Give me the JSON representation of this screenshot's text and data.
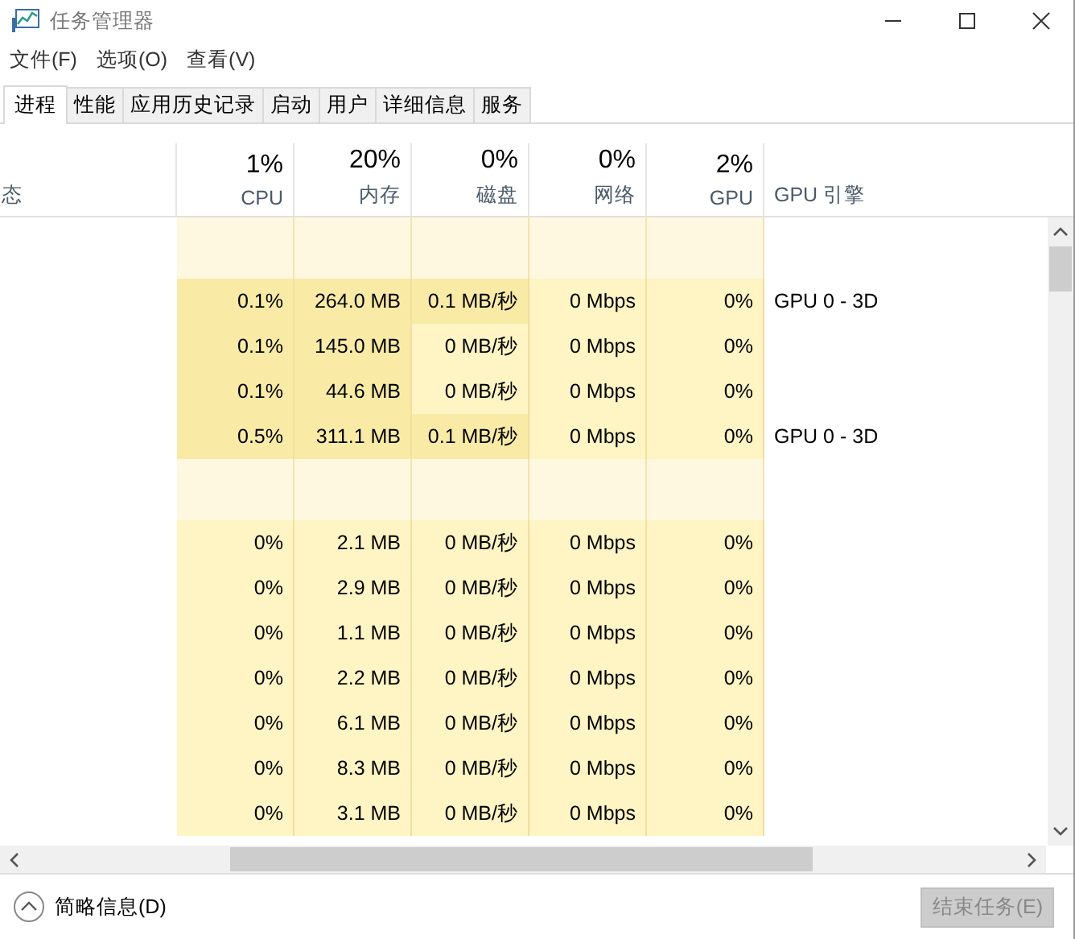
{
  "window": {
    "title": "任务管理器"
  },
  "menu": [
    "文件(F)",
    "选项(O)",
    "查看(V)"
  ],
  "tabs": [
    {
      "label": "进程",
      "selected": true
    },
    {
      "label": "性能",
      "selected": false
    },
    {
      "label": "应用历史记录",
      "selected": false
    },
    {
      "label": "启动",
      "selected": false
    },
    {
      "label": "用户",
      "selected": false
    },
    {
      "label": "详细信息",
      "selected": false
    },
    {
      "label": "服务",
      "selected": false
    }
  ],
  "table": {
    "columns": [
      {
        "label": "态"
      },
      {
        "percent": "1%",
        "label": "CPU"
      },
      {
        "percent": "20%",
        "label": "内存"
      },
      {
        "percent": "0%",
        "label": "磁盘"
      },
      {
        "percent": "0%",
        "label": "网络"
      },
      {
        "percent": "2%",
        "label": "GPU"
      },
      {
        "label": "GPU 引擎"
      }
    ],
    "rows": [
      {
        "kind": "group"
      },
      {
        "kind": "process",
        "cells": [
          {
            "text": "0.1%",
            "heat": true
          },
          {
            "text": "264.0 MB",
            "heat": true
          },
          {
            "text": "0.1 MB/秒",
            "heat": true
          },
          {
            "text": "0 Mbps",
            "heat": false
          },
          {
            "text": "0%",
            "heat": false
          }
        ],
        "engine": "GPU 0 - 3D"
      },
      {
        "kind": "process",
        "cells": [
          {
            "text": "0.1%",
            "heat": true
          },
          {
            "text": "145.0 MB",
            "heat": true
          },
          {
            "text": "0 MB/秒",
            "heat": false
          },
          {
            "text": "0 Mbps",
            "heat": false
          },
          {
            "text": "0%",
            "heat": false
          }
        ]
      },
      {
        "kind": "process",
        "cells": [
          {
            "text": "0.1%",
            "heat": true
          },
          {
            "text": "44.6 MB",
            "heat": true
          },
          {
            "text": "0 MB/秒",
            "heat": false
          },
          {
            "text": "0 Mbps",
            "heat": false
          },
          {
            "text": "0%",
            "heat": false
          }
        ]
      },
      {
        "kind": "process",
        "cells": [
          {
            "text": "0.5%",
            "heat": true
          },
          {
            "text": "311.1 MB",
            "heat": true
          },
          {
            "text": "0.1 MB/秒",
            "heat": true
          },
          {
            "text": "0 Mbps",
            "heat": false
          },
          {
            "text": "0%",
            "heat": false
          }
        ],
        "engine": "GPU 0 - 3D"
      },
      {
        "kind": "group"
      },
      {
        "kind": "process",
        "cells": [
          {
            "text": "0%",
            "heat": false
          },
          {
            "text": "2.1 MB",
            "heat": false
          },
          {
            "text": "0 MB/秒",
            "heat": false
          },
          {
            "text": "0 Mbps",
            "heat": false
          },
          {
            "text": "0%",
            "heat": false
          }
        ]
      },
      {
        "kind": "process",
        "cells": [
          {
            "text": "0%",
            "heat": false
          },
          {
            "text": "2.9 MB",
            "heat": false
          },
          {
            "text": "0 MB/秒",
            "heat": false
          },
          {
            "text": "0 Mbps",
            "heat": false
          },
          {
            "text": "0%",
            "heat": false
          }
        ]
      },
      {
        "kind": "process",
        "cells": [
          {
            "text": "0%",
            "heat": false
          },
          {
            "text": "1.1 MB",
            "heat": false
          },
          {
            "text": "0 MB/秒",
            "heat": false
          },
          {
            "text": "0 Mbps",
            "heat": false
          },
          {
            "text": "0%",
            "heat": false
          }
        ]
      },
      {
        "kind": "process",
        "cells": [
          {
            "text": "0%",
            "heat": false
          },
          {
            "text": "2.2 MB",
            "heat": false
          },
          {
            "text": "0 MB/秒",
            "heat": false
          },
          {
            "text": "0 Mbps",
            "heat": false
          },
          {
            "text": "0%",
            "heat": false
          }
        ]
      },
      {
        "kind": "process",
        "cells": [
          {
            "text": "0%",
            "heat": false
          },
          {
            "text": "6.1 MB",
            "heat": false
          },
          {
            "text": "0 MB/秒",
            "heat": false
          },
          {
            "text": "0 Mbps",
            "heat": false
          },
          {
            "text": "0%",
            "heat": false
          }
        ]
      },
      {
        "kind": "process",
        "cells": [
          {
            "text": "0%",
            "heat": false
          },
          {
            "text": "8.3 MB",
            "heat": false
          },
          {
            "text": "0 MB/秒",
            "heat": false
          },
          {
            "text": "0 Mbps",
            "heat": false
          },
          {
            "text": "0%",
            "heat": false
          }
        ]
      },
      {
        "kind": "process",
        "cells": [
          {
            "text": "0%",
            "heat": false
          },
          {
            "text": "3.1 MB",
            "heat": false
          },
          {
            "text": "0 MB/秒",
            "heat": false
          },
          {
            "text": "0 Mbps",
            "heat": false
          },
          {
            "text": "0%",
            "heat": false
          }
        ]
      }
    ]
  },
  "footer": {
    "details_toggle": "简略信息(D)",
    "end_task": {
      "label": "结束任务(E)",
      "disabled": true
    }
  }
}
